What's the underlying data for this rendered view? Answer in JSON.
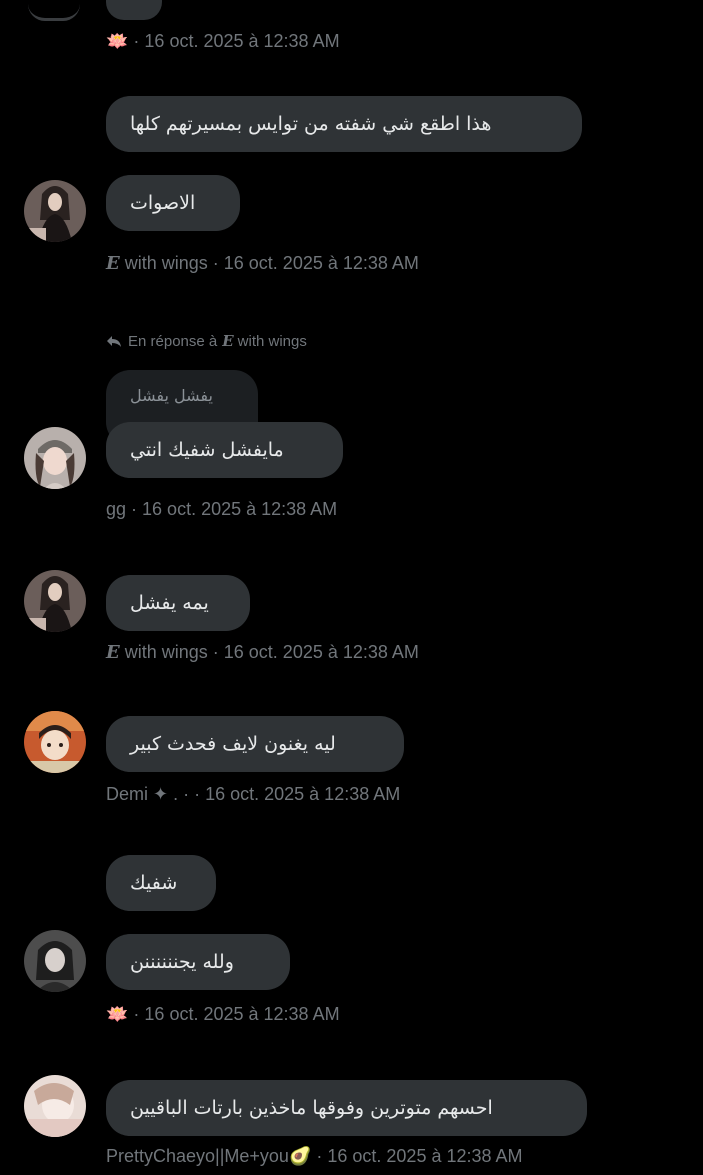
{
  "messages": [
    {
      "meta": {
        "user": "",
        "emoji": "🪷",
        "time": "16 oct. 2025 à 12:38 AM"
      }
    },
    {
      "bubbles": [
        "هذا اطقع شي شفته من توايس بمسيرتهم كلها",
        "الاصوات"
      ],
      "avatar": "avatar-ewings",
      "meta": {
        "prefix": "E",
        "user": "with wings",
        "time": "16 oct. 2025 à 12:38 AM"
      }
    },
    {
      "reply": {
        "label": "En réponse à",
        "prefix": "E",
        "target": "with wings",
        "quoted": "يفشل يفشل"
      },
      "bubbles": [
        "مايفشل شفيك انتي"
      ],
      "avatar": "avatar-gg",
      "meta": {
        "user": "gg",
        "time": "16 oct. 2025 à 12:38 AM"
      }
    },
    {
      "bubbles": [
        "يمه يفشل"
      ],
      "avatar": "avatar-ewings",
      "meta": {
        "prefix": "E",
        "user": "with wings",
        "time": "16 oct. 2025 à 12:38 AM"
      }
    },
    {
      "bubbles": [
        "ليه يغنون لايف فحدث كبير"
      ],
      "avatar": "avatar-demi",
      "meta": {
        "user": "Demi ✦ . ·",
        "time": "16 oct. 2025 à 12:38 AM"
      }
    },
    {
      "bubbles": [
        "شفيك",
        "ولله يجننننننن"
      ],
      "avatar": "avatar-lotus-user",
      "meta": {
        "user": "",
        "emoji": "🪷",
        "time": "16 oct. 2025 à 12:38 AM"
      }
    },
    {
      "bubbles": [
        "احسهم متوترين وفوقها ماخذين بارتات الباقيين"
      ],
      "avatar": "avatar-prettychaeyo",
      "meta": {
        "user": "PrettyChaeyo||Me+you",
        "emoji": "🥑",
        "time": "16 oct. 2025 à 12:38 AM"
      }
    }
  ],
  "separator": "·",
  "colors": {
    "background": "#000000",
    "bubble": "#2f3336",
    "meta_text": "#71767b",
    "text": "#e7e9ea"
  }
}
